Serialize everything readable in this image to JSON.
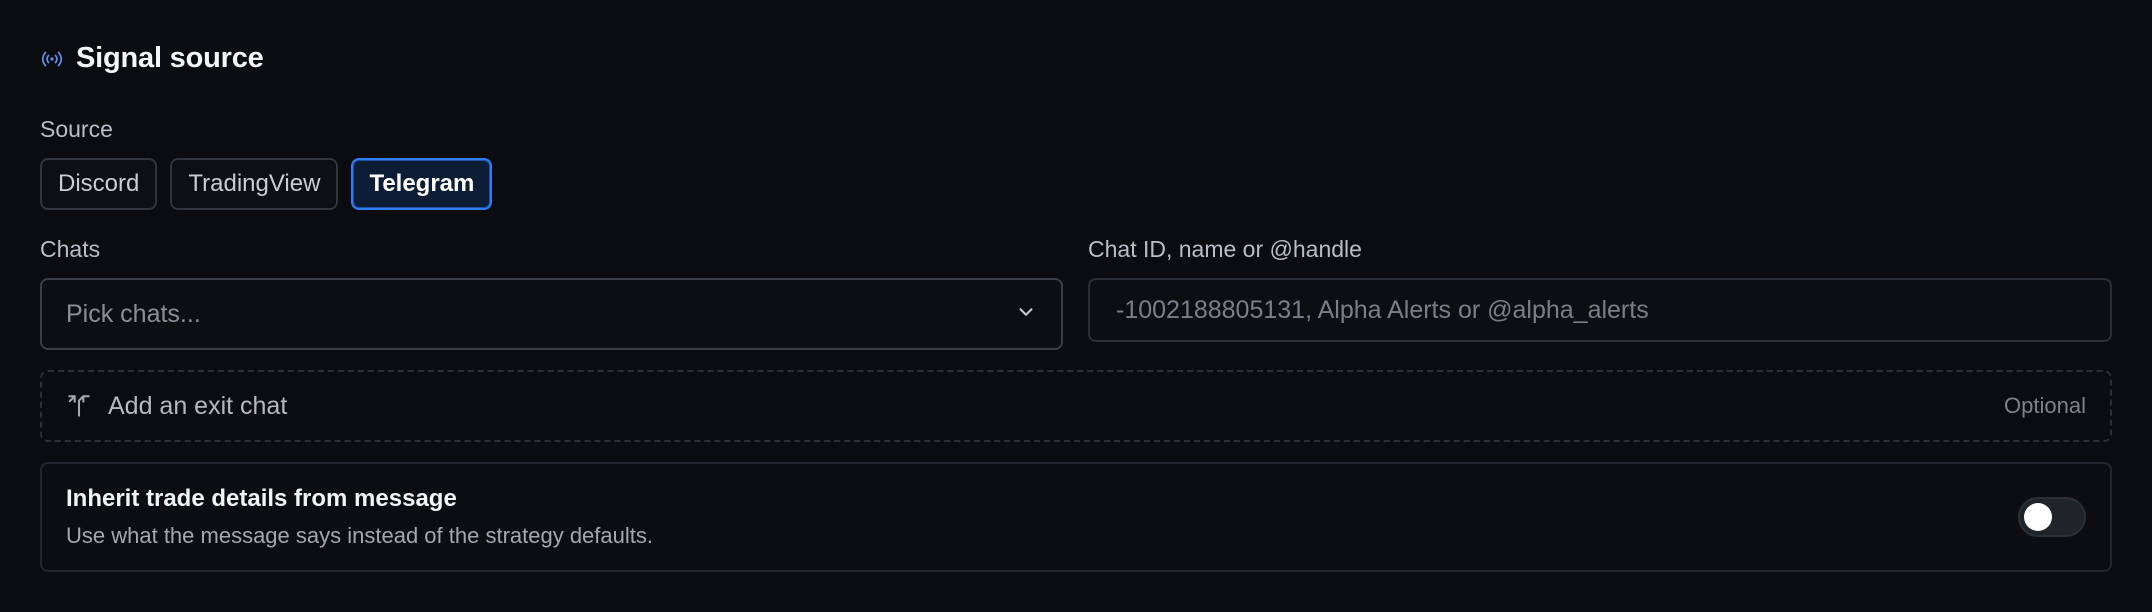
{
  "section": {
    "title": "Signal source",
    "icon": "broadcast-icon",
    "accent": "#5b8fe6"
  },
  "source": {
    "label": "Source",
    "options": [
      "Discord",
      "TradingView",
      "Telegram"
    ],
    "selected": "Telegram"
  },
  "chats": {
    "label": "Chats",
    "placeholder": "Pick chats...",
    "icon": "chevron-down-icon"
  },
  "chat_id": {
    "label": "Chat ID, name or @handle",
    "placeholder": "-1002188805131, Alpha Alerts or @alpha_alerts",
    "value": ""
  },
  "exit_chat": {
    "label": "Add an exit chat",
    "badge": "Optional",
    "icon": "split-arrow-icon"
  },
  "inherit": {
    "title": "Inherit trade details from message",
    "description": "Use what the message says instead of the strategy defaults.",
    "enabled": false
  },
  "colors": {
    "background": "#0a0c10",
    "active_border": "#2f7df6",
    "active_fill": "#0e1d36"
  }
}
